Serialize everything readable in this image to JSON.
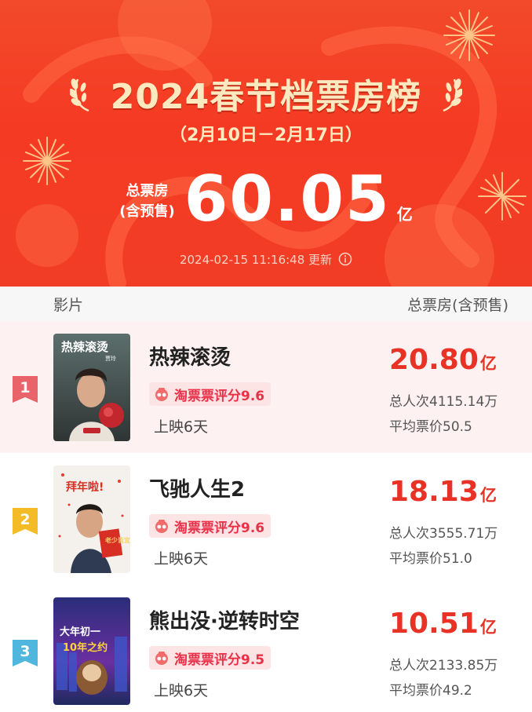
{
  "header": {
    "title": "2024春节档票房榜",
    "date_range": "（2月10日－2月17日）",
    "total_label_line1": "总票房",
    "total_label_line2": "(含预售)",
    "total_value": "60.05",
    "total_unit": "亿",
    "update_text": "2024-02-15 11:16:48 更新"
  },
  "table": {
    "col_film": "影片",
    "col_box": "总票房(含预售)"
  },
  "movies": [
    {
      "rank": "1",
      "name": "热辣滚烫",
      "score": "淘票票评分9.6",
      "days": "上映6天",
      "box_value": "20.80",
      "box_unit": "亿",
      "viewers": "总人次4115.14万",
      "avg_price": "平均票价50.5"
    },
    {
      "rank": "2",
      "name": "飞驰人生2",
      "score": "淘票票评分9.6",
      "days": "上映6天",
      "box_value": "18.13",
      "box_unit": "亿",
      "viewers": "总人次3555.71万",
      "avg_price": "平均票价51.0"
    },
    {
      "rank": "3",
      "name": "熊出没·逆转时空",
      "score": "淘票票评分9.5",
      "days": "上映6天",
      "box_value": "10.51",
      "box_unit": "亿",
      "viewers": "总人次2133.85万",
      "avg_price": "平均票价49.2"
    }
  ],
  "posters": [
    {
      "text": "热辣滚烫",
      "sub": "贾玲"
    },
    {
      "text": "拜年啦!",
      "sub": "老少皆宜"
    },
    {
      "text": "大年初一",
      "sub": "10年之约"
    }
  ],
  "colors": {
    "banner_red": "#f23d26",
    "title_cream": "#fde9c0",
    "box_red": "#e83226",
    "rank1": "#e8646a",
    "rank2": "#f3bb26",
    "rank3": "#4fb6dd",
    "score_bg": "#fde4e4"
  }
}
